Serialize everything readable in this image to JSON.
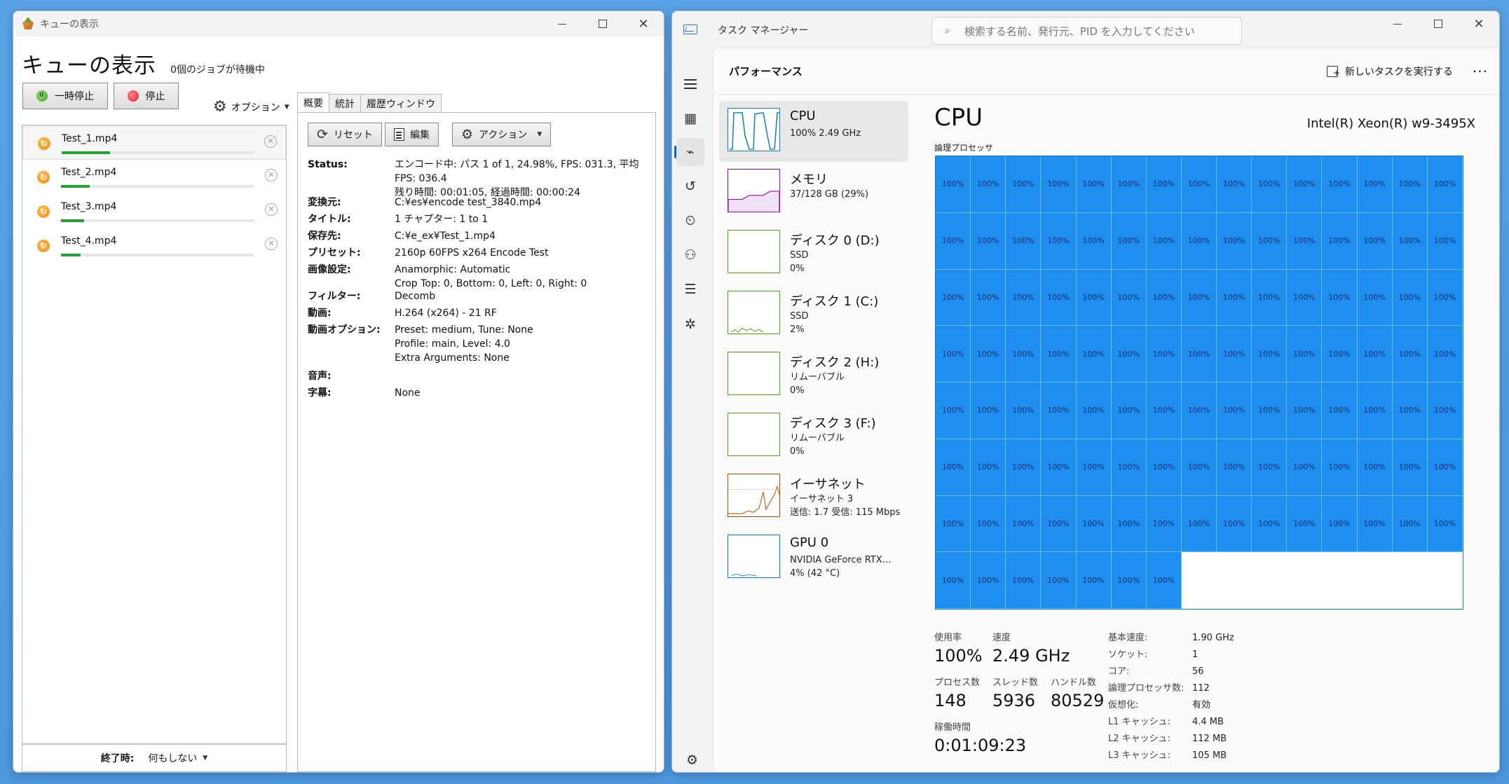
{
  "queue_window": {
    "title": "キューの表示",
    "heading": "キューの表示",
    "jobs_waiting": "0個のジョブが待機中",
    "pause_label": "一時停止",
    "stop_label": "停止",
    "options_label": "オプション",
    "items": [
      {
        "name": "Test_1.mp4",
        "progress": 0.25
      },
      {
        "name": "Test_2.mp4",
        "progress": 0.15
      },
      {
        "name": "Test_3.mp4",
        "progress": 0.12
      },
      {
        "name": "Test_4.mp4",
        "progress": 0.1
      }
    ],
    "footer": {
      "label": "終了時:",
      "value": "何もしない"
    },
    "tabs": [
      "概要",
      "統計",
      "履歴ウィンドウ"
    ],
    "toolbar": {
      "reset": "リセット",
      "edit": "編集",
      "action": "アクション"
    },
    "summary": [
      {
        "key": "Status:",
        "value": "エンコード中: パス 1 of 1,  24.98%, FPS: 031.3,  平均FPS: 036.4\n残り時間: 00:01:05,  経過時間: 00:00:24"
      },
      {
        "key": "変換元:",
        "value": "C:¥es¥encode test_3840.mp4"
      },
      {
        "key": "タイトル:",
        "value": "1   チャプター:  1  to  1"
      },
      {
        "key": "保存先:",
        "value": "C:¥e_ex¥Test_1.mp4"
      },
      {
        "key": "プリセット:",
        "value": "2160p 60FPS x264 Encode Test"
      },
      {
        "key": "画像設定:",
        "value": "Anamorphic: Automatic\nCrop Top: 0, Bottom: 0, Left: 0, Right: 0"
      },
      {
        "key": "フィルター:",
        "value": "Decomb"
      },
      {
        "key": "動画:",
        "value": "H.264 (x264) - 21 RF"
      },
      {
        "key": "動画オプション:",
        "value": "Preset: medium, Tune: None\nProfile: main, Level: 4.0\nExtra Arguments: None"
      },
      {
        "key": "音声:",
        "value": ""
      },
      {
        "key": "字幕:",
        "value": "None"
      }
    ]
  },
  "task_manager": {
    "title": "タスク マネージャー",
    "search_placeholder": "検索する名前、発行元、PID を入力してください",
    "page_title": "パフォーマンス",
    "new_task": "新しいタスクを実行する",
    "more": "···",
    "resources": [
      {
        "name": "CPU",
        "sub": "100%  2.49 GHz",
        "kind": "cpu"
      },
      {
        "name": "メモリ",
        "sub": "37/128 GB (29%)",
        "kind": "mem"
      },
      {
        "name": "ディスク 0 (D:)",
        "sub": "SSD\n0%",
        "kind": "disk"
      },
      {
        "name": "ディスク 1 (C:)",
        "sub": "SSD\n2%",
        "kind": "disk"
      },
      {
        "name": "ディスク 2 (H:)",
        "sub": "リムーバブル\n0%",
        "kind": "disk"
      },
      {
        "name": "ディスク 3 (F:)",
        "sub": "リムーバブル\n0%",
        "kind": "disk"
      },
      {
        "name": "イーサネット",
        "sub": "イーサネット 3\n送信: 1.7  受信: 115 Mbps",
        "kind": "eth"
      },
      {
        "name": "GPU 0",
        "sub": "NVIDIA GeForce RTX…\n4% (42 °C)",
        "kind": "gpu"
      }
    ],
    "cpu": {
      "heading": "CPU",
      "model": "Intel(R) Xeon(R) w9-3495X",
      "grid_label": "論理プロセッサ",
      "core_count": 112,
      "core_value": "100%",
      "utilization_label": "使用率",
      "utilization": "100%",
      "speed_label": "速度",
      "speed": "2.49 GHz",
      "processes_label": "プロセス数",
      "processes": "148",
      "threads_label": "スレッド数",
      "threads": "5936",
      "handles_label": "ハンドル数",
      "handles": "80529",
      "uptime_label": "稼働時間",
      "uptime": "0:01:09:23",
      "specs": [
        {
          "k": "基本速度:",
          "v": "1.90 GHz"
        },
        {
          "k": "ソケット:",
          "v": "1"
        },
        {
          "k": "コア:",
          "v": "56"
        },
        {
          "k": "論理プロセッサ数:",
          "v": "112"
        },
        {
          "k": "仮想化:",
          "v": "有効"
        },
        {
          "k": "L1 キャッシュ:",
          "v": "4.4 MB"
        },
        {
          "k": "L2 キャッシュ:",
          "v": "112 MB"
        },
        {
          "k": "L3 キャッシュ:",
          "v": "105 MB"
        }
      ]
    }
  }
}
